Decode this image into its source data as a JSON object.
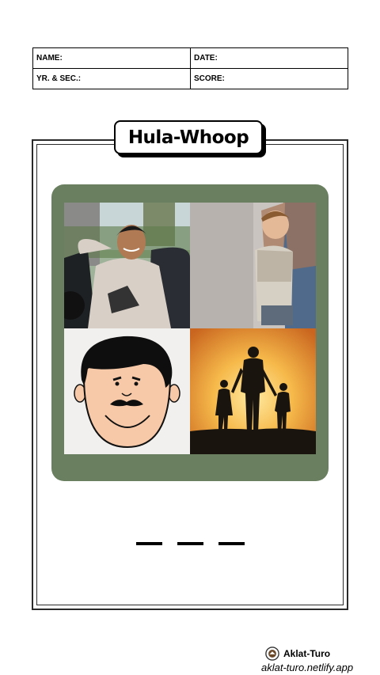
{
  "header": {
    "name_label": "NAME:",
    "date_label": "DATE:",
    "section_label": "YR. & SEC.:",
    "score_label": "SCORE:"
  },
  "title": "Hula-Whoop",
  "pictures": [
    {
      "icon": "young-man-photo"
    },
    {
      "icon": "child-clinging-to-parent-photo"
    },
    {
      "icon": "cartoon-mustache-face"
    },
    {
      "icon": "family-silhouette-sunset"
    }
  ],
  "answer_blanks": 3,
  "colors": {
    "panel": "#6a7f5f",
    "frame": "#2a2a2a",
    "sunset": "#f3a53a"
  },
  "footer": {
    "brand": "Aklat-Turo",
    "url": "aklat-turo.netlify.app"
  }
}
